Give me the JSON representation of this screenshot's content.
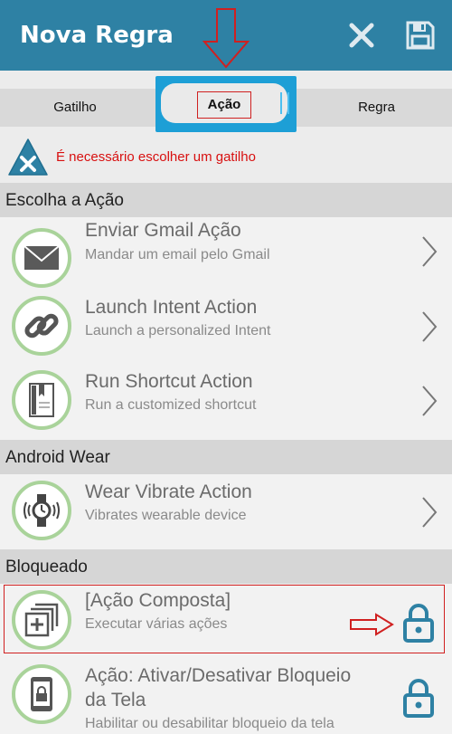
{
  "header": {
    "title": "Nova Regra",
    "close_icon": "close-icon",
    "save_icon": "save-icon"
  },
  "tabs": [
    {
      "label": "Gatilho"
    },
    {
      "label": "Ação",
      "selected": true
    },
    {
      "label": "Regra"
    }
  ],
  "warning": {
    "icon": "warning-icon",
    "text": "É necessário escolher um gatilho",
    "color": "#d81010"
  },
  "sections": [
    {
      "label": "Escolha a Ação"
    },
    {
      "label": "Android Wear"
    },
    {
      "label": "Bloqueado"
    }
  ],
  "actions": [
    {
      "title": "Enviar Gmail Ação",
      "subtitle": "Mandar um email pelo Gmail",
      "icon": "mail-icon",
      "locked": false
    },
    {
      "title": "Launch Intent Action",
      "subtitle": "Launch a personalized Intent",
      "icon": "link-icon",
      "locked": false
    },
    {
      "title": "Run Shortcut Action",
      "subtitle": "Run a customized shortcut",
      "icon": "shortcut-icon",
      "locked": false
    },
    {
      "title": "Wear Vibrate Action",
      "subtitle": "Vibrates wearable device",
      "icon": "watch-vibrate-icon",
      "locked": false
    },
    {
      "title": "[Ação Composta]",
      "subtitle": "Executar várias ações",
      "icon": "composite-icon",
      "locked": true
    },
    {
      "title_line1": "Ação: Ativar/Desativar Bloqueio",
      "title_line2": "da Tela",
      "subtitle": "Habilitar ou desabilitar bloqueio da tela",
      "icon": "phone-lock-icon",
      "locked": true
    }
  ],
  "colors": {
    "appbar": "#2e81a4",
    "accent_circle": "#a9d39a",
    "lock": "#2e81a4",
    "annotation": "#d02020"
  }
}
